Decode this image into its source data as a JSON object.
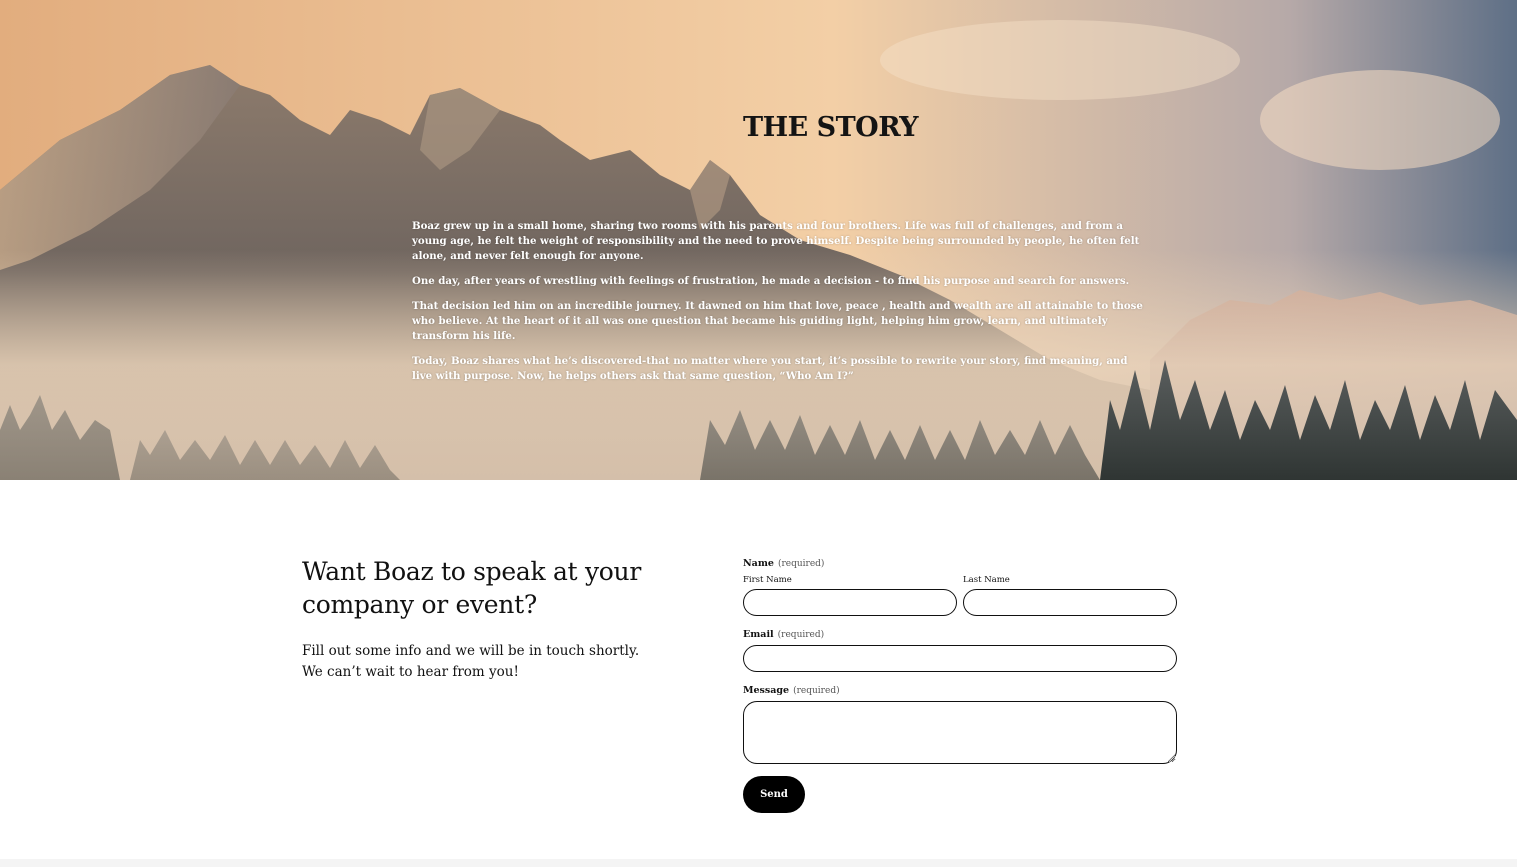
{
  "story": {
    "title": "THE STORY",
    "paragraphs": [
      "Boaz grew up in a small home, sharing two rooms with his parents and four brothers. Life was full of challenges, and from a young age, he felt the weight of responsibility and the need to prove himself. Despite being surrounded by people, he often felt alone, and never felt enough for anyone.",
      "One day, after years of wrestling with feelings of frustration, he made a decision - to find his purpose and search for answers.",
      "That decision led him on an incredible journey. It dawned on him that love, peace , health and wealth are all attainable to those who believe. At the heart of it all was one question that became his guiding light, helping him grow, learn, and ultimately transform his life.",
      "Today, Boaz shares what he’s discovered-that no matter where you start, it’s possible to rewrite your story, find meaning, and live with purpose. Now, he helps others ask that same question, “Who Am I?”"
    ]
  },
  "contact": {
    "heading": "Want Boaz to speak at your company or event?",
    "subtext": "Fill out some info and we will be in touch shortly. We can’t wait to hear from you!"
  },
  "form": {
    "name_label": "Name",
    "required_text": "(required)",
    "first_name_label": "First Name",
    "last_name_label": "Last Name",
    "first_name_value": "",
    "last_name_value": "",
    "email_label": "Email",
    "email_value": "",
    "message_label": "Message",
    "message_value": "",
    "send_label": "Send"
  }
}
